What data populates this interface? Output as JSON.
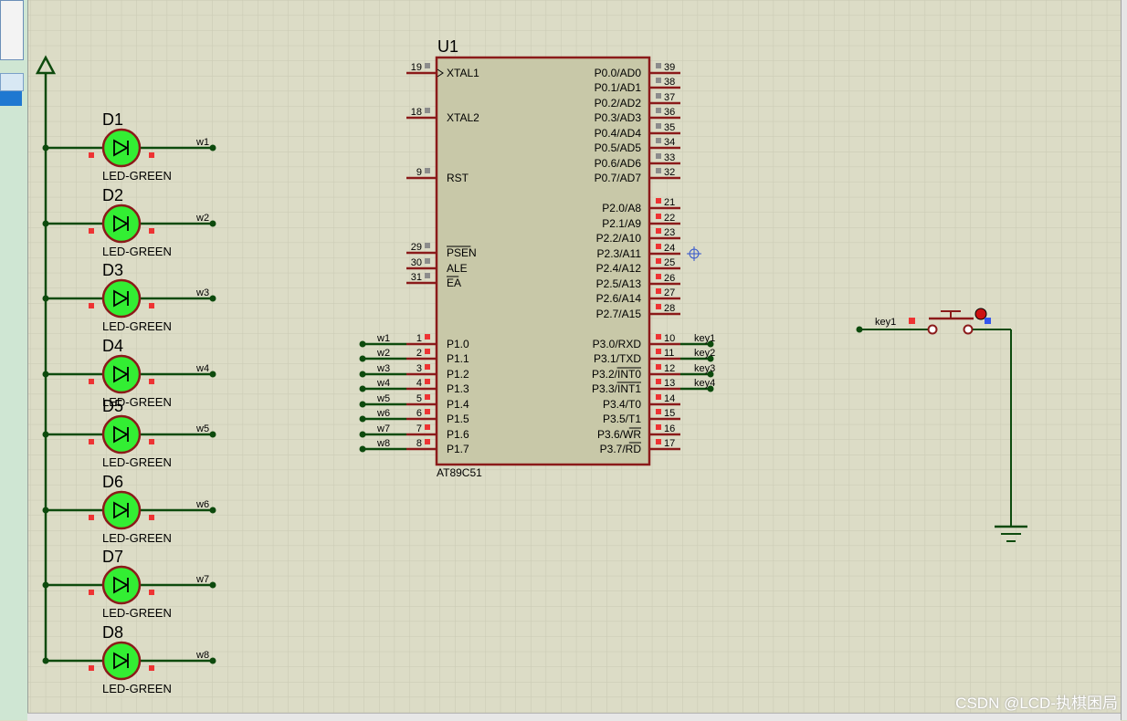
{
  "mcu": {
    "ref": "U1",
    "part": "AT89C51",
    "left_pins": [
      {
        "num": "19",
        "name": "XTAL1"
      },
      {
        "num": "18",
        "name": "XTAL2"
      },
      {
        "num": "9",
        "name": "RST"
      },
      {
        "num": "29",
        "name": "PSEN"
      },
      {
        "num": "30",
        "name": "ALE"
      },
      {
        "num": "31",
        "name": "EA"
      },
      {
        "num": "1",
        "name": "P1.0",
        "net": "w1"
      },
      {
        "num": "2",
        "name": "P1.1",
        "net": "w2"
      },
      {
        "num": "3",
        "name": "P1.2",
        "net": "w3"
      },
      {
        "num": "4",
        "name": "P1.3",
        "net": "w4"
      },
      {
        "num": "5",
        "name": "P1.4",
        "net": "w5"
      },
      {
        "num": "6",
        "name": "P1.5",
        "net": "w6"
      },
      {
        "num": "7",
        "name": "P1.6",
        "net": "w7"
      },
      {
        "num": "8",
        "name": "P1.7",
        "net": "w8"
      }
    ],
    "right_pins": [
      {
        "num": "39",
        "name": "P0.0/AD0"
      },
      {
        "num": "38",
        "name": "P0.1/AD1"
      },
      {
        "num": "37",
        "name": "P0.2/AD2"
      },
      {
        "num": "36",
        "name": "P0.3/AD3"
      },
      {
        "num": "35",
        "name": "P0.4/AD4"
      },
      {
        "num": "34",
        "name": "P0.5/AD5"
      },
      {
        "num": "33",
        "name": "P0.6/AD6"
      },
      {
        "num": "32",
        "name": "P0.7/AD7"
      },
      {
        "num": "21",
        "name": "P2.0/A8"
      },
      {
        "num": "22",
        "name": "P2.1/A9"
      },
      {
        "num": "23",
        "name": "P2.2/A10"
      },
      {
        "num": "24",
        "name": "P2.3/A11"
      },
      {
        "num": "25",
        "name": "P2.4/A12"
      },
      {
        "num": "26",
        "name": "P2.5/A13"
      },
      {
        "num": "27",
        "name": "P2.6/A14"
      },
      {
        "num": "28",
        "name": "P2.7/A15"
      },
      {
        "num": "10",
        "name": "P3.0/RXD",
        "net": "key1"
      },
      {
        "num": "11",
        "name": "P3.1/TXD",
        "net": "key2"
      },
      {
        "num": "12",
        "name": "P3.2/INT0",
        "net": "key3"
      },
      {
        "num": "13",
        "name": "P3.3/INT1",
        "net": "key4"
      },
      {
        "num": "14",
        "name": "P3.4/T0"
      },
      {
        "num": "15",
        "name": "P3.5/T1"
      },
      {
        "num": "16",
        "name": "P3.6/WR"
      },
      {
        "num": "17",
        "name": "P3.7/RD"
      }
    ]
  },
  "leds": [
    {
      "ref": "D1",
      "value": "LED-GREEN",
      "net": "w1"
    },
    {
      "ref": "D2",
      "value": "LED-GREEN",
      "net": "w2"
    },
    {
      "ref": "D3",
      "value": "LED-GREEN",
      "net": "w3"
    },
    {
      "ref": "D4",
      "value": "LED-GREEN",
      "net": "w4"
    },
    {
      "ref": "D5",
      "value": "LED-GREEN",
      "net": "w5"
    },
    {
      "ref": "D6",
      "value": "LED-GREEN",
      "net": "w6"
    },
    {
      "ref": "D7",
      "value": "LED-GREEN",
      "net": "w7"
    },
    {
      "ref": "D8",
      "value": "LED-GREEN",
      "net": "w8"
    }
  ],
  "button": {
    "net": "key1"
  },
  "watermark": "CSDN @LCD-执棋困局",
  "colors": {
    "background": "#dcdcc6",
    "grid": "#c9c9b3",
    "chip_fill": "#c8c8a8",
    "component_outline": "#8b1a1a",
    "wire": "#0d4a0d",
    "led_fill": "#33ee33",
    "pin_marker": "#ee3333"
  }
}
